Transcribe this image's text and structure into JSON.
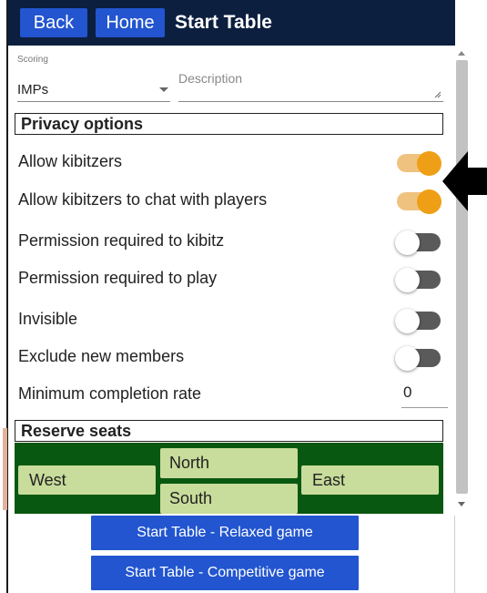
{
  "header": {
    "back_label": "Back",
    "home_label": "Home",
    "title": "Start Table"
  },
  "scoring": {
    "label": "Scoring",
    "selected": "IMPs"
  },
  "description": {
    "placeholder": "Description",
    "value": ""
  },
  "privacy": {
    "heading": "Privacy options",
    "options": [
      {
        "label": "Allow kibitzers",
        "on": true
      },
      {
        "label": "Allow kibitzers to chat with players",
        "on": true
      },
      {
        "label": "Permission required to kibitz",
        "on": false
      },
      {
        "label": "Permission required to play",
        "on": false
      },
      {
        "label": "Invisible",
        "on": false
      },
      {
        "label": "Exclude new members",
        "on": false
      }
    ],
    "min_completion_label": "Minimum completion rate",
    "min_completion_value": "0"
  },
  "reserve": {
    "heading": "Reserve seats",
    "north": "North",
    "south": "South",
    "east": "East",
    "west": "West"
  },
  "actions": {
    "relaxed_label": "Start Table - Relaxed game",
    "competitive_label": "Start Table - Competitive game"
  },
  "icons": {
    "pointer_arrow": "arrow-left-icon",
    "resize": "resize-handle-icon",
    "dropdown": "chevron-down-icon"
  },
  "colors": {
    "header_bg": "#0c1f3f",
    "button_blue": "#2255cf",
    "toggle_on_knob": "#ef9f15",
    "toggle_on_track": "#f0c27f",
    "toggle_off_track": "#5a5a5a",
    "table_green": "#095811",
    "seat_green": "#c8dc9b"
  }
}
